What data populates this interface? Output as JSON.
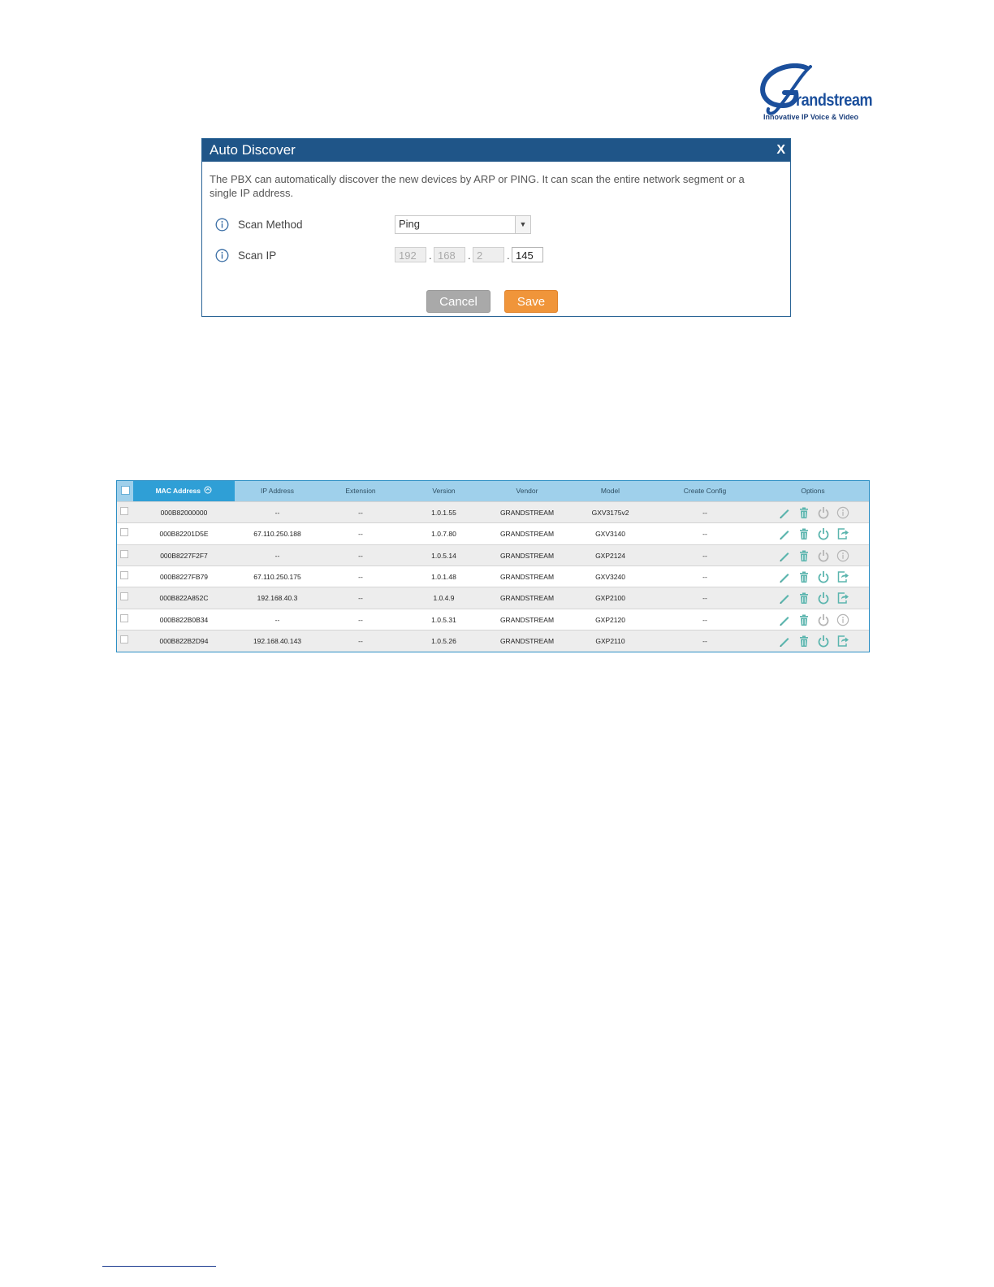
{
  "logo": {
    "wordmark": "randstream",
    "tagline": "Innovative IP Voice & Video"
  },
  "dialog": {
    "title": "Auto Discover",
    "close_label": "X",
    "description": "The PBX can automatically discover the new devices by ARP or PING. It can scan the entire network segment or a single IP address.",
    "scan_method": {
      "label": "Scan Method",
      "value": "Ping"
    },
    "scan_ip": {
      "label": "Scan IP",
      "octets": [
        "192",
        "168",
        "2",
        "145"
      ],
      "separator": "."
    },
    "cancel_label": "Cancel",
    "save_label": "Save"
  },
  "table": {
    "headers": [
      "MAC Address",
      "IP Address",
      "Extension",
      "Version",
      "Vendor",
      "Model",
      "Create Config",
      "Options"
    ],
    "rows": [
      {
        "mac": "000B82000000",
        "ip": "--",
        "ext": "--",
        "version": "1.0.1.55",
        "vendor": "GRANDSTREAM",
        "model": "GXV3175v2",
        "config": "--",
        "options": [
          "edit",
          "delete",
          "reboot-disabled",
          "info"
        ]
      },
      {
        "mac": "000B82201D5E",
        "ip": "67.110.250.188",
        "ext": "--",
        "version": "1.0.7.80",
        "vendor": "GRANDSTREAM",
        "model": "GXV3140",
        "config": "--",
        "options": [
          "edit",
          "delete",
          "reboot",
          "export"
        ]
      },
      {
        "mac": "000B8227F2F7",
        "ip": "--",
        "ext": "--",
        "version": "1.0.5.14",
        "vendor": "GRANDSTREAM",
        "model": "GXP2124",
        "config": "--",
        "options": [
          "edit",
          "delete",
          "reboot-disabled",
          "info"
        ]
      },
      {
        "mac": "000B8227FB79",
        "ip": "67.110.250.175",
        "ext": "--",
        "version": "1.0.1.48",
        "vendor": "GRANDSTREAM",
        "model": "GXV3240",
        "config": "--",
        "options": [
          "edit",
          "delete",
          "reboot",
          "export"
        ]
      },
      {
        "mac": "000B822A852C",
        "ip": "192.168.40.3",
        "ext": "--",
        "version": "1.0.4.9",
        "vendor": "GRANDSTREAM",
        "model": "GXP2100",
        "config": "--",
        "options": [
          "edit",
          "delete",
          "reboot",
          "export"
        ]
      },
      {
        "mac": "000B822B0B34",
        "ip": "--",
        "ext": "--",
        "version": "1.0.5.31",
        "vendor": "GRANDSTREAM",
        "model": "GXP2120",
        "config": "--",
        "options": [
          "edit",
          "delete",
          "reboot-disabled",
          "info"
        ]
      },
      {
        "mac": "000B822B2D94",
        "ip": "192.168.40.143",
        "ext": "--",
        "version": "1.0.5.26",
        "vendor": "GRANDSTREAM",
        "model": "GXP2110",
        "config": "--",
        "options": [
          "edit",
          "delete",
          "reboot",
          "export"
        ]
      }
    ]
  },
  "colors": {
    "dialog_header": "#1f5588",
    "save_button": "#f0953a",
    "cancel_button": "#a9a9a9",
    "table_header": "#9fd0eb",
    "active_header": "#2f9fd6",
    "icon_teal": "#5bb5ae",
    "icon_gray": "#b5b5b5"
  }
}
